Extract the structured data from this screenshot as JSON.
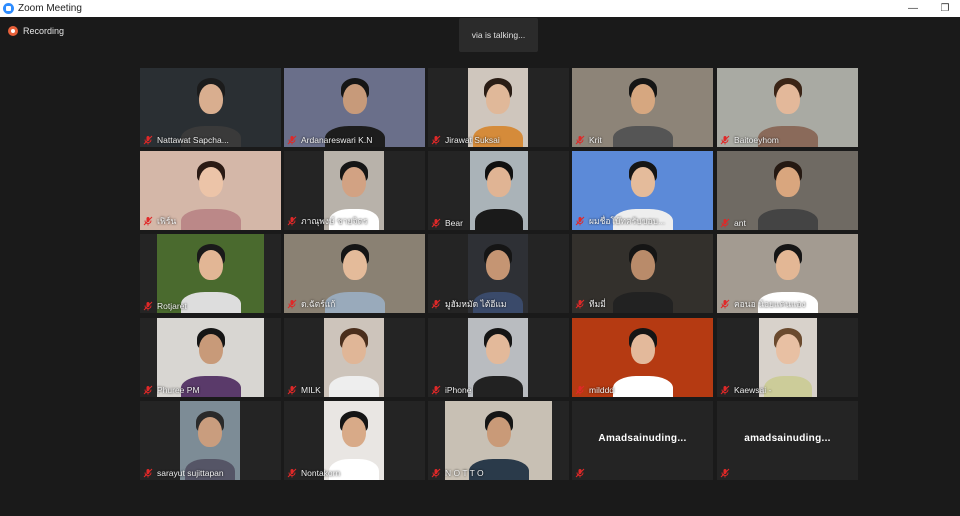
{
  "window": {
    "title": "Zoom Meeting",
    "minimize_glyph": "—",
    "restore_glyph": "❐"
  },
  "recording": {
    "label": "Recording",
    "icon": "recording-icon"
  },
  "active_speaker": {
    "text": "via is talking..."
  },
  "colors": {
    "mic_muted": "#e02828",
    "tile_bg": "#242424",
    "background": "#1a1a1a"
  },
  "participants": [
    {
      "name": "Nattawat Sapcha...",
      "video": true,
      "muted": true
    },
    {
      "name": "Ardanareswari K.N",
      "video": true,
      "muted": true
    },
    {
      "name": "Jirawat Suksai",
      "video": true,
      "muted": true
    },
    {
      "name": "Krit",
      "video": true,
      "muted": true
    },
    {
      "name": "Baitoeyhom",
      "video": true,
      "muted": true
    },
    {
      "name": "เฟิร์น",
      "video": true,
      "muted": true
    },
    {
      "name": "ภาณุพงษ์ ชายจิตร",
      "video": true,
      "muted": true
    },
    {
      "name": "Bear",
      "video": true,
      "muted": true
    },
    {
      "name": "ผมชื่อโบ๊ทครับขอบ...",
      "video": true,
      "muted": true
    },
    {
      "name": "ant",
      "video": true,
      "muted": true
    },
    {
      "name": "Rotjaret",
      "video": true,
      "muted": true
    },
    {
      "name": "ด.ฉัตร์แก้",
      "video": true,
      "muted": true
    },
    {
      "name": "มูฮัมหมัด ไต้อีแม",
      "video": true,
      "muted": true
    },
    {
      "name": "ทีมมี่",
      "video": true,
      "muted": true
    },
    {
      "name": "คอนอ น้อยแคนแอง",
      "video": true,
      "muted": true
    },
    {
      "name": "Phuree PM",
      "video": true,
      "muted": true
    },
    {
      "name": "MILK",
      "video": true,
      "muted": true
    },
    {
      "name": "iPhone",
      "video": true,
      "muted": true
    },
    {
      "name": "milddd",
      "video": true,
      "muted": true
    },
    {
      "name": "Kaewsai -",
      "video": true,
      "muted": true
    },
    {
      "name": "sarayut sujittapan",
      "video": true,
      "muted": true
    },
    {
      "name": "Nontakorn",
      "video": true,
      "muted": true
    },
    {
      "name": "N O T T O",
      "video": true,
      "muted": true
    },
    {
      "name": "Amadsainuding...",
      "video": false,
      "muted": true
    },
    {
      "name": "amadsainuding...",
      "video": false,
      "muted": true
    }
  ]
}
